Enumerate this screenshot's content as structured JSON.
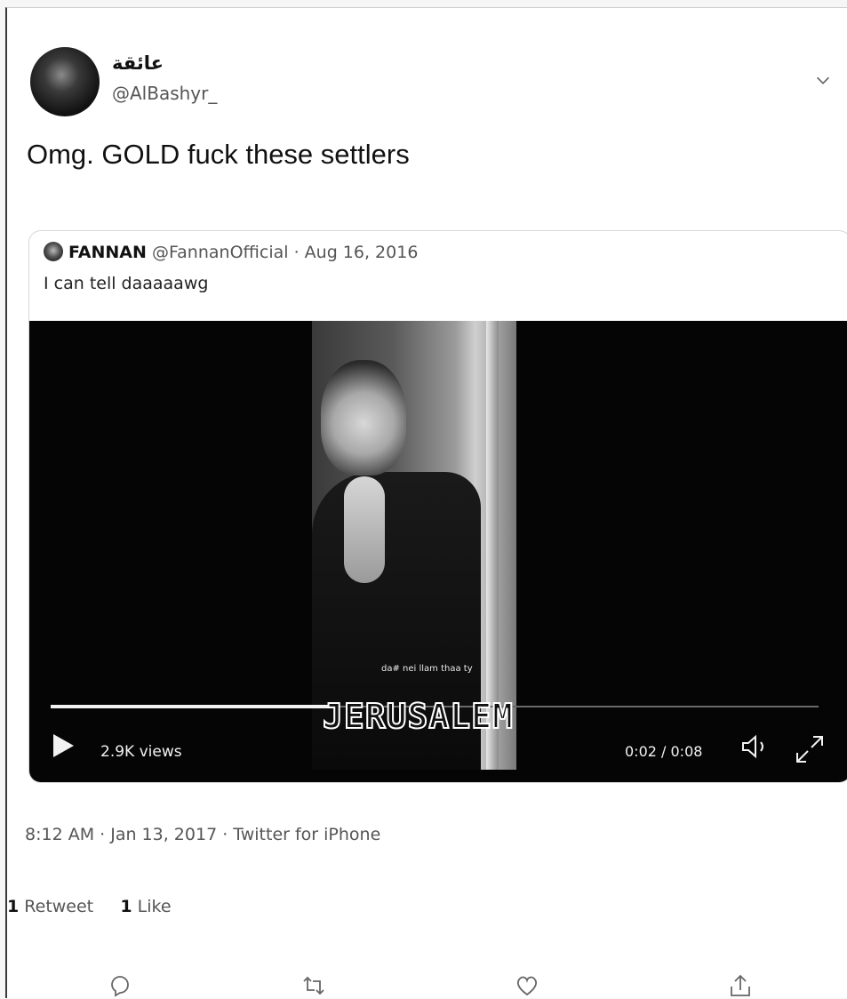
{
  "tweet": {
    "display_name": "عائقة",
    "handle": "@AlBashyr_",
    "text": "Omg. GOLD fuck these settlers",
    "timestamp": "8:12 AM · Jan 13, 2017 · Twitter for iPhone",
    "retweets_count": "1",
    "retweets_label": "Retweet",
    "likes_count": "1",
    "likes_label": "Like"
  },
  "quoted": {
    "name": "FANNAN",
    "handle_date": "@FannanOfficial · Aug 16, 2016",
    "text": "I can tell daaaaawg"
  },
  "video": {
    "views": "2.9K views",
    "time": "0:02 / 0:08",
    "progress": 0.37,
    "subtitle": "da# nei llam thaa ty",
    "banner": "JERUSALEM"
  },
  "icons": [
    "chevron-down-icon",
    "play-icon",
    "volume-icon",
    "fullscreen-icon",
    "reply-icon",
    "retweet-icon",
    "like-icon",
    "share-icon"
  ]
}
